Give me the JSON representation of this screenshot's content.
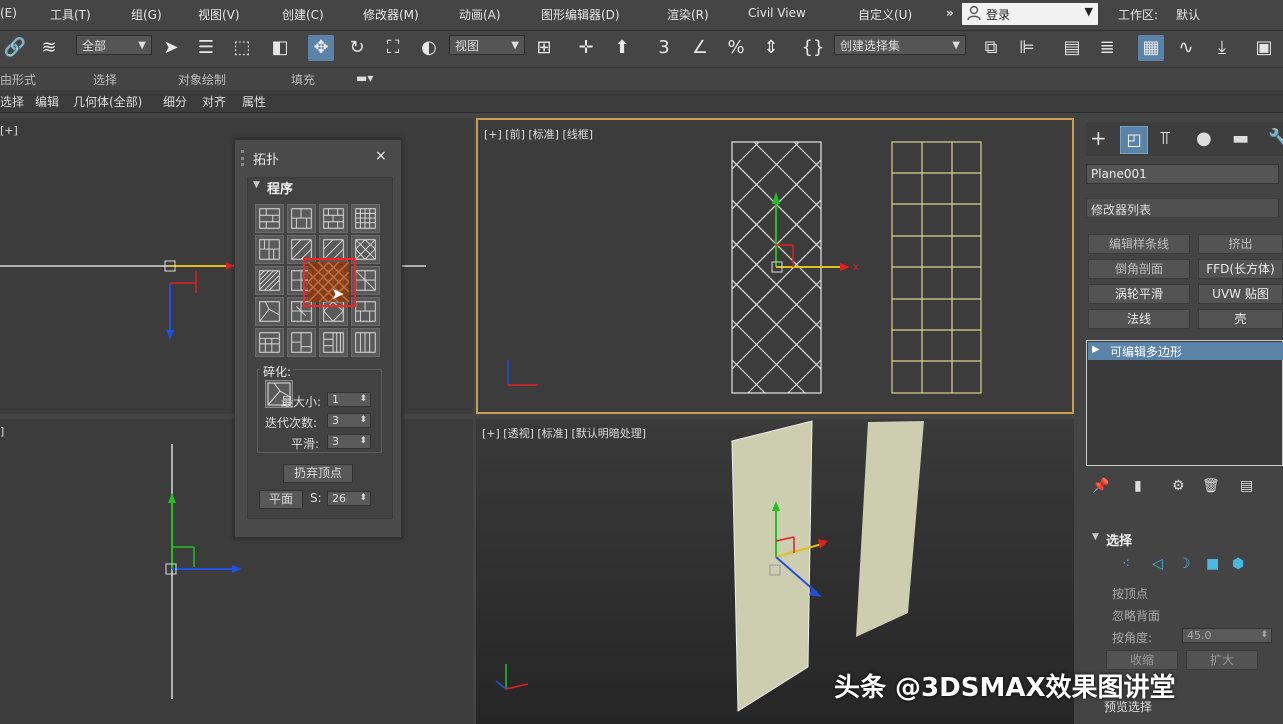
{
  "menubar": {
    "items": [
      "(E)",
      "工具(T)",
      "组(G)",
      "视图(V)",
      "创建(C)",
      "修改器(M)",
      "动画(A)",
      "图形编辑器(D)",
      "渲染(R)",
      "Civil View",
      "自定义(U)"
    ],
    "overflow": "»",
    "login": "登录",
    "workspace_label": "工作区:",
    "workspace_value": "默认"
  },
  "toolbar": {
    "filter_value": "全部",
    "ref_coord_value": "视图",
    "selection_set_value": "创建选择集",
    "icons": [
      "link-icon",
      "bind-space-warp-icon",
      "select-icon",
      "select-by-name-icon",
      "rect-region-icon",
      "window-crossing-icon",
      "move-icon",
      "rotate-icon",
      "scale-icon",
      "select-manipulate-icon",
      "pivot-icon",
      "snap-icon",
      "angle-snap-icon",
      "percent-snap-icon",
      "spinner-snap-icon",
      "edit-named-sets-icon",
      "mirror-icon",
      "align-icon",
      "layer-explorer-icon",
      "scene-explorer-icon",
      "toggle-ribbon-icon",
      "curve-editor-icon",
      "schematic-view-icon",
      "material-editor-icon"
    ]
  },
  "ribbon": {
    "tabs": [
      "由形式",
      "选择",
      "对象绘制",
      "填充"
    ],
    "subtabs": [
      "选择",
      "编辑",
      "几何体(全部)",
      "细分",
      "对齐",
      "属性"
    ]
  },
  "viewports": {
    "top_left_label": "[+]",
    "bottom_left_label": "]",
    "front_label": "[+] [前] [标准] [线框]",
    "perspective_label": "[+] [透视] [标准] [默认明暗处理]"
  },
  "topology_panel": {
    "title": "拓扑",
    "close": "×",
    "section": "程序",
    "sub_section": "碎化:",
    "size_label": "最大小:",
    "size_value": "1",
    "iter_label": "迭代次数:",
    "iter_value": "3",
    "smooth_label": "平滑:",
    "smooth_value": "3",
    "drop_button": "扔弃顶点",
    "plane_button": "平面",
    "s_label": "S:",
    "s_value": "26"
  },
  "command_panel": {
    "object_name": "Plane001",
    "modifier_list": "修改器列表",
    "buttons": [
      "编辑样条线",
      "挤出",
      "倒角剖面",
      "FFD(长方体)",
      "涡轮平滑",
      "UVW 贴图",
      "法线",
      "壳"
    ],
    "stack_item": "可编辑多边形",
    "selection_title": "选择",
    "by_vertex": "按顶点",
    "ignore_backface": "忽略背面",
    "by_angle": "按角度:",
    "by_angle_value": "45.0",
    "shrink": "收缩",
    "grow": "扩大",
    "preview": "预览选择"
  },
  "watermark": "头条 @3DSMAX效果图讲堂",
  "colors": {
    "accent": "#5b83a8",
    "viewport_border": "#c8a050",
    "selection_red": "#ff2020",
    "plane_fill": "#cdcdb0"
  }
}
